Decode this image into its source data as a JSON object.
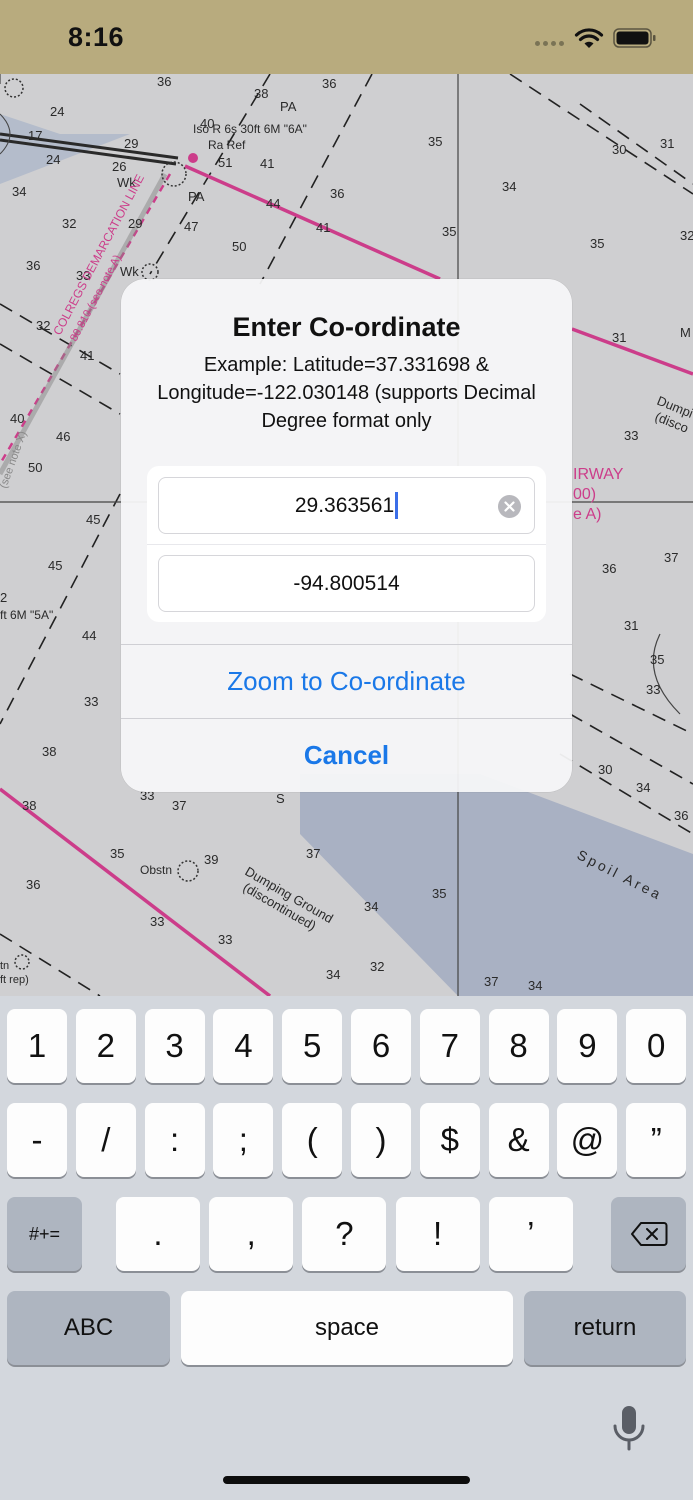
{
  "status_bar": {
    "time": "8:16"
  },
  "chart": {
    "soundings": [
      "36",
      "24",
      "38",
      "36",
      "PA",
      "17",
      "29",
      "40",
      "24",
      "26",
      "Wk",
      "51",
      "41",
      "35",
      "34",
      "34",
      "32",
      "29",
      "PA",
      "47",
      "44",
      "36",
      "31",
      "30",
      "35",
      "36",
      "33",
      "Wk",
      "50",
      "41",
      "35",
      "32",
      "31",
      "32",
      "41",
      "40",
      "46",
      "50",
      "45",
      "45",
      "44",
      "33",
      "38",
      "38",
      "35",
      "36",
      "33",
      "33",
      "34",
      "32",
      "33",
      "37",
      "S",
      "39",
      "37",
      "35",
      "34",
      "37",
      "34",
      "33",
      "35",
      "33",
      "30",
      "34",
      "36",
      "37",
      "36",
      "31",
      "33",
      "33",
      "33"
    ],
    "labels": {
      "light": "Iso R 6s 30ft 6M \"6A\"",
      "ra_ref": "Ra Ref",
      "demarcation": "COLREGS DEMARCATION LINE",
      "demarcation_sub": "80.810 (see note A)",
      "see_note_x": "(see note X)",
      "dumping_ground": "Dumping Ground",
      "discontinued": "(discontinued)",
      "obstn": "Obstn",
      "spoil_area": "Spoil Area",
      "fairway": "IRWAY",
      "fairway_sub": "00)",
      "note_a": "e A)",
      "dumping_right": "Dumpi",
      "disco_right": "(disco",
      "sixa_left": "ft 6M \"5A\"",
      "two": "2",
      "tn": "tn",
      "ft_rep": "ft rep)",
      "m_right": "M"
    }
  },
  "dialog": {
    "title": "Enter Co-ordinate",
    "message": "Example: Latitude=37.331698 & Longitude=-122.030148 (supports Decimal Degree format only",
    "latitude_value": "29.363561",
    "longitude_value": "-94.800514",
    "zoom_button": "Zoom to Co-ordinate",
    "cancel_button": "Cancel"
  },
  "keyboard": {
    "row1": [
      "1",
      "2",
      "3",
      "4",
      "5",
      "6",
      "7",
      "8",
      "9",
      "0"
    ],
    "row2": [
      "-",
      "/",
      ":",
      ";",
      "(",
      ")",
      "$",
      "&",
      "@",
      "”"
    ],
    "row3": [
      ".",
      ",",
      "?",
      "!",
      "’"
    ],
    "more_symbols": "#+=",
    "abc": "ABC",
    "space": "space",
    "return": "return"
  },
  "colors": {
    "status_bar": "#b8ab7e",
    "accent_blue": "#1a78e8",
    "chart_magenta": "#cc3d8a",
    "keyboard_bg": "#d3d7dd"
  }
}
